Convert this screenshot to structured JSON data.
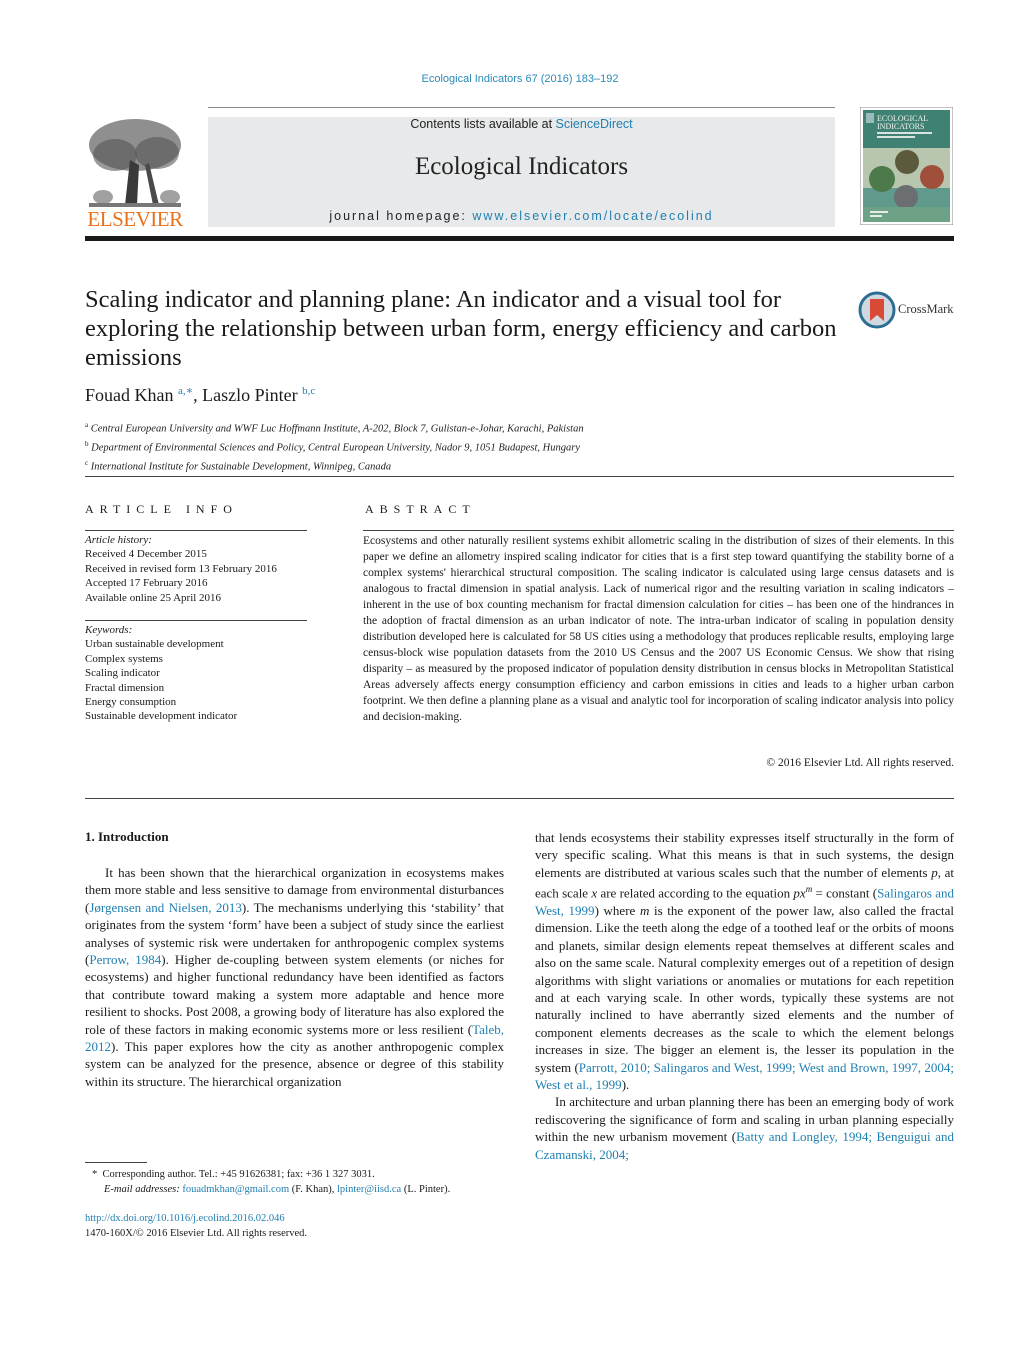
{
  "header": {
    "journal_ref": "Ecological Indicators 67 (2016) 183–192",
    "contents_prefix": "Contents lists available at ",
    "contents_link": "ScienceDirect",
    "journal_name": "Ecological Indicators",
    "homepage_prefix": "journal homepage: ",
    "homepage_link": "www.elsevier.com/locate/ecolind",
    "publisher_logo_text": "ELSEVIER",
    "cover_title_line1": "ECOLOGICAL",
    "cover_title_line2": "INDICATORS",
    "colors": {
      "link": "#1f7fb0",
      "publisher_orange": "#e9711c",
      "band": "#e8e9ea"
    }
  },
  "article": {
    "title": "Scaling indicator and planning plane: An indicator and a visual tool for exploring the relationship between urban form, energy efficiency and carbon emissions",
    "crossmark_label": "CrossMark",
    "authors": [
      {
        "name": "Fouad Khan",
        "sup": "a,∗"
      },
      {
        "name": "Laszlo Pinter",
        "sup": "b,c"
      }
    ],
    "author_separator": ", ",
    "affiliations": [
      {
        "mark": "a",
        "text": "Central European University and WWF Luc Hoffmann Institute, A-202, Block 7, Gulistan-e-Johar, Karachi, Pakistan"
      },
      {
        "mark": "b",
        "text": "Department of Environmental Sciences and Policy, Central European University, Nador 9, 1051 Budapest, Hungary"
      },
      {
        "mark": "c",
        "text": "International Institute for Sustainable Development, Winnipeg, Canada"
      }
    ]
  },
  "article_info": {
    "heading": "ARTICLE INFO",
    "history_label": "Article history:",
    "history": [
      "Received 4 December 2015",
      "Received in revised form 13 February 2016",
      "Accepted 17 February 2016",
      "Available online 25 April 2016"
    ],
    "keywords_label": "Keywords:",
    "keywords": [
      "Urban sustainable development",
      "Complex systems",
      "Scaling indicator",
      "Fractal dimension",
      "Energy consumption",
      "Sustainable development indicator"
    ]
  },
  "abstract": {
    "heading": "ABSTRACT",
    "text": "Ecosystems and other naturally resilient systems exhibit allometric scaling in the distribution of sizes of their elements. In this paper we define an allometry inspired scaling indicator for cities that is a first step toward quantifying the stability borne of a complex systems' hierarchical structural composition. The scaling indicator is calculated using large census datasets and is analogous to fractal dimension in spatial analysis. Lack of numerical rigor and the resulting variation in scaling indicators – inherent in the use of box counting mechanism for fractal dimension calculation for cities – has been one of the hindrances in the adoption of fractal dimension as an urban indicator of note. The intra-urban indicator of scaling in population density distribution developed here is calculated for 58 US cities using a methodology that produces replicable results, employing large census-block wise population datasets from the 2010 US Census and the 2007 US Economic Census. We show that rising disparity – as measured by the proposed indicator of population density distribution in census blocks in Metropolitan Statistical Areas adversely affects energy consumption efficiency and carbon emissions in cities and leads to a higher urban carbon footprint. We then define a planning plane as a visual and analytic tool for incorporation of scaling indicator analysis into policy and decision-making.",
    "copyright": "© 2016 Elsevier Ltd. All rights reserved."
  },
  "body": {
    "section_heading": "1.  Introduction",
    "left_para": [
      {
        "t": "It has been shown that the hierarchical organization in ecosystems makes them more stable and less sensitive to damage from environmental disturbances ("
      },
      {
        "link": "Jørgensen and Nielsen, 2013"
      },
      {
        "t": "). The mechanisms underlying this ‘stability’ that originates from the system ‘form’ have been a subject of study since the earliest analyses of systemic risk were undertaken for anthropogenic complex systems ("
      },
      {
        "link": "Perrow, 1984"
      },
      {
        "t": "). Higher de-coupling between system elements (or niches for ecosystems) and higher functional redundancy have been identified as factors that contribute toward making a system more adaptable and hence more resilient to shocks. Post 2008, a growing body of literature has also explored the role of these factors in making economic systems more or less resilient ("
      },
      {
        "link": "Taleb, 2012"
      },
      {
        "t": "). This paper explores how the city as another anthropogenic complex system can be analyzed for the presence, absence or degree of this stability within its structure. The hierarchical organization"
      }
    ],
    "right_para1": [
      {
        "t": "that lends ecosystems their stability expresses itself structurally in the form of very specific scaling. What this means is that in such systems, the design elements are distributed at various scales such that the number of elements "
      },
      {
        "i": "p"
      },
      {
        "t": ", at each scale "
      },
      {
        "i": "x"
      },
      {
        "t": " are related according to the equation "
      },
      {
        "i": "px"
      },
      {
        "sup": "m"
      },
      {
        "t": " = constant ("
      },
      {
        "link": "Salingaros and West, 1999"
      },
      {
        "t": ") where "
      },
      {
        "i": "m"
      },
      {
        "t": " is the exponent of the power law, also called the fractal dimension. Like the teeth along the edge of a toothed leaf or the orbits of moons and planets, similar design elements repeat themselves at different scales and also on the same scale. Natural complexity emerges out of a repetition of design algorithms with slight variations or anomalies or mutations for each repetition and at each varying scale. In other words, typically these systems are not naturally inclined to have aberrantly sized elements and the number of component elements decreases as the scale to which the element belongs increases in size. The bigger an element is, the lesser its population in the system ("
      },
      {
        "link": "Parrott, 2010; Salingaros and West, 1999; West and Brown, 1997, 2004; West et al., 1999"
      },
      {
        "t": ")."
      }
    ],
    "right_para2": [
      {
        "t": "In architecture and urban planning there has been an emerging body of work rediscovering the significance of form and scaling in urban planning especially within the new urbanism movement ("
      },
      {
        "link": "Batty and Longley, 1994; Benguigui and Czamanski, 2004;"
      }
    ]
  },
  "footnotes": {
    "corresponding": "Corresponding author. Tel.: +45 91626381; fax: +36 1 327 3031.",
    "corresponding_mark": "*",
    "email_label": "E-mail addresses:",
    "email1": "fouadmkhan@gmail.com",
    "email1_owner": " (F. Khan), ",
    "email2": "lpinter@iisd.ca",
    "email2_owner": " (L. Pinter).",
    "doi": "http://dx.doi.org/10.1016/j.ecolind.2016.02.046",
    "issn_line": "1470-160X/© 2016 Elsevier Ltd. All rights reserved."
  }
}
